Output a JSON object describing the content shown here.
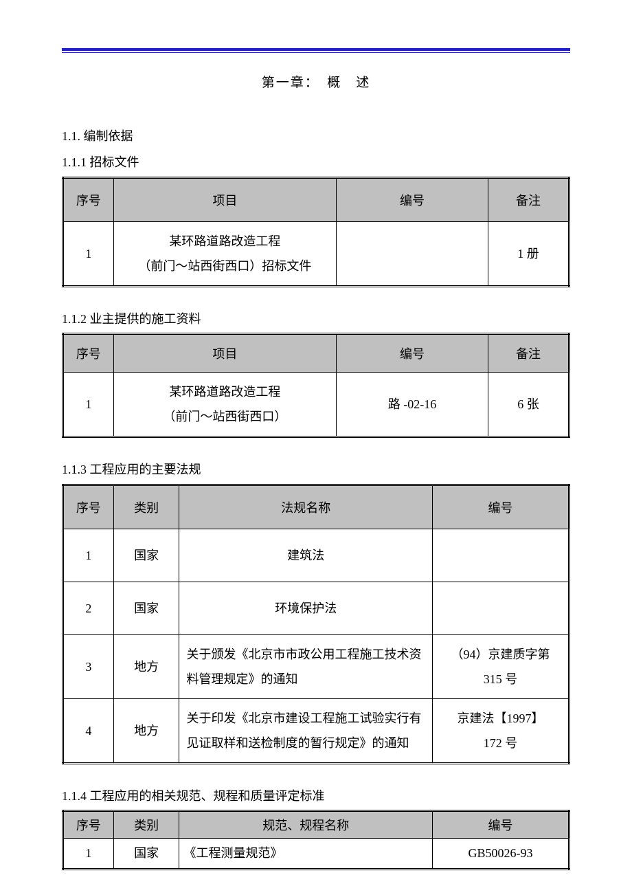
{
  "chapter_title": "第一章：　概　述",
  "section_1_1": "1.1. 编制依据",
  "section_1_1_1": "1.1.1 招标文件",
  "table1": {
    "headers": [
      "序号",
      "项目",
      "编号",
      "备注"
    ],
    "rows": [
      {
        "seq": "1",
        "item_l1": "某环路道路改造工程",
        "item_l2": "（前门～站西街西口）招标文件",
        "code": "",
        "note": "1 册"
      }
    ]
  },
  "section_1_1_2": "1.1.2 业主提供的施工资料",
  "table2": {
    "headers": [
      "序号",
      "项目",
      "编号",
      "备注"
    ],
    "rows": [
      {
        "seq": "1",
        "item_l1": "某环路道路改造工程",
        "item_l2": "（前门～站西街西口）",
        "code": "路 -02-16",
        "note": "6 张"
      }
    ]
  },
  "section_1_1_3": "1.1.3 工程应用的主要法规",
  "table3": {
    "headers": [
      "序号",
      "类别",
      "法规名称",
      "编号"
    ],
    "rows": [
      {
        "seq": "1",
        "cat": "国家",
        "name": "建筑法",
        "code": ""
      },
      {
        "seq": "2",
        "cat": "国家",
        "name": "环境保护法",
        "code": ""
      },
      {
        "seq": "3",
        "cat": "地方",
        "name": "关于颁发《北京市市政公用工程施工技术资料管理规定》的通知",
        "code_l1": "（94）京建质字第",
        "code_l2": "315 号"
      },
      {
        "seq": "4",
        "cat": "地方",
        "name": "关于印发《北京市建设工程施工试验实行有见证取样和送检制度的暂行规定》的通知",
        "code_l1": "京建法【1997】",
        "code_l2": "172 号"
      }
    ]
  },
  "section_1_1_4": "1.1.4 工程应用的相关规范、规程和质量评定标准",
  "table4": {
    "headers": [
      "序号",
      "类别",
      "规范、规程名称",
      "编号"
    ],
    "rows": [
      {
        "seq": "1",
        "cat": "国家",
        "name": "《工程测量规范》",
        "code": "GB50026-93"
      }
    ]
  }
}
